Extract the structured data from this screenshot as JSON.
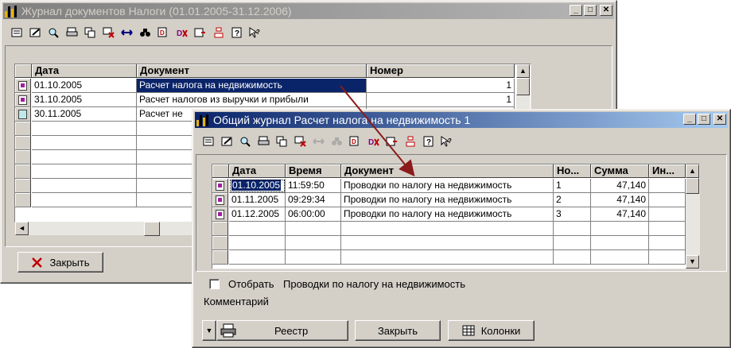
{
  "journal_window": {
    "title": "Журнал документов  Налоги (01.01.2005-31.12.2006)",
    "columns": [
      "Дата",
      "Документ",
      "Номер"
    ],
    "rows": [
      {
        "date": "01.10.2005",
        "doc": "Расчет налога на недвижимость",
        "num": "1"
      },
      {
        "date": "31.10.2005",
        "doc": "Расчет налогов из выручки и прибыли",
        "num": "1"
      },
      {
        "date": "30.11.2005",
        "doc": "Расчет не",
        "num": ""
      }
    ],
    "close_label": "Закрыть"
  },
  "general_window": {
    "title": "Общий журнал  Расчет налога на недвижимость 1",
    "columns": [
      "Дата",
      "Время",
      "Документ",
      "Но...",
      "Сумма",
      "Ин..."
    ],
    "rows": [
      {
        "date": "01.10.2005",
        "time": "11:59:50",
        "doc": "Проводки по налогу на недвижимость",
        "num": "1",
        "sum": "47,140"
      },
      {
        "date": "01.11.2005",
        "time": "09:29:34",
        "doc": "Проводки по налогу на недвижимость",
        "num": "2",
        "sum": "47,140"
      },
      {
        "date": "01.12.2005",
        "time": "06:00:00",
        "doc": "Проводки по налогу на недвижимость",
        "num": "3",
        "sum": "47,140"
      }
    ],
    "filter_label": "Отобрать",
    "filter_value": "Проводки по налогу на недвижимость",
    "comment_label": "Комментарий",
    "registry_label": "Реестр",
    "close_label": "Закрыть",
    "columns_label": "Колонки"
  },
  "window_buttons": {
    "minimize": "_",
    "maximize": "□",
    "close": "✕"
  },
  "colors": {
    "selection": "#0a246a",
    "active_title": "#0a246a",
    "arrow": "#8b1a1a"
  }
}
